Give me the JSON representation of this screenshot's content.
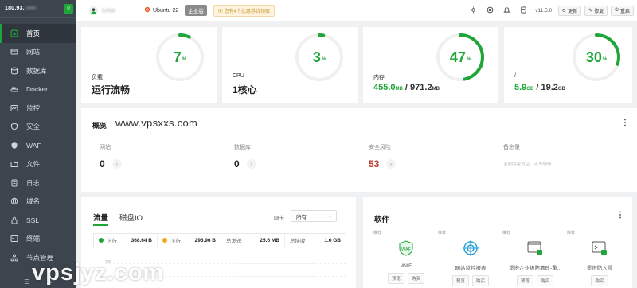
{
  "sidebar": {
    "ip": "180.93.",
    "ip_hidden": "▪▪▪▪▪",
    "count": "0",
    "items": [
      {
        "label": "首页",
        "icon": "home-icon"
      },
      {
        "label": "网站",
        "icon": "globe-icon"
      },
      {
        "label": "数据库",
        "icon": "database-icon"
      },
      {
        "label": "Docker",
        "icon": "docker-icon"
      },
      {
        "label": "监控",
        "icon": "monitor-icon"
      },
      {
        "label": "安全",
        "icon": "shield-icon"
      },
      {
        "label": "WAF",
        "icon": "waf-icon"
      },
      {
        "label": "文件",
        "icon": "folder-icon"
      },
      {
        "label": "日志",
        "icon": "log-icon"
      },
      {
        "label": "域名",
        "icon": "domain-icon"
      },
      {
        "label": "SSL",
        "icon": "ssl-icon"
      },
      {
        "label": "终端",
        "icon": "terminal-icon"
      },
      {
        "label": "节点管理",
        "icon": "node-icon"
      }
    ],
    "footer": [
      "☰",
      "✎"
    ]
  },
  "topbar": {
    "user": "Linux",
    "os": "Ubuntu 22",
    "edition": "企业版",
    "coupon": "您有4个优惠券待领取",
    "version": "v11.5.0",
    "btn_update": "更新",
    "btn_repair": "修复",
    "btn_restart": "重启"
  },
  "stats": [
    {
      "label": "负载",
      "value": "运行流畅",
      "percent": 7
    },
    {
      "label": "CPU",
      "value": "1核心",
      "percent": 3
    },
    {
      "label": "内存",
      "used": "455.0",
      "used_unit": "MB",
      "slash": " / ",
      "total": "971.2",
      "total_unit": "MB",
      "percent": 47
    },
    {
      "label": "/",
      "used": "5.9",
      "used_unit": "GB",
      "slash": " / ",
      "total": "19.2",
      "total_unit": "GB",
      "percent": 30
    }
  ],
  "percent_sign": "%",
  "overview": {
    "title": "概览",
    "site": "www.vpsxxs.com",
    "cols": [
      {
        "label": "网站",
        "value": "0"
      },
      {
        "label": "数据库",
        "value": "0"
      },
      {
        "label": "安全风险",
        "value": "53"
      },
      {
        "label": "备忘录",
        "note": "当前内容为空，点击编辑"
      }
    ]
  },
  "traffic": {
    "tab1": "流量",
    "tab2": "磁盘IO",
    "nic_label": "网卡",
    "nic_value": "所有",
    "up_label": "上行",
    "up_value": "368.64 B",
    "down_label": "下行",
    "down_value": "296.96 B",
    "sent_label": "总发送",
    "sent_value": "25.6 MB",
    "recv_label": "总接收",
    "recv_value": "1.0 GB",
    "axis_tick": "200",
    "colors": {
      "up": "#20a53a",
      "down": "#f5a623"
    }
  },
  "software": {
    "title": "软件",
    "items": [
      {
        "tag": "推荐",
        "name": "WAF",
        "btn1": "预览",
        "btn2": "购买"
      },
      {
        "tag": "推荐",
        "name": "网站监控报表",
        "btn1": "预览",
        "btn2": "购买"
      },
      {
        "tag": "推荐",
        "name": "堡塔企业级防篡改-重...",
        "btn1": "预览",
        "btn2": "购买"
      },
      {
        "tag": "推荐",
        "name": "堡塔防入侵",
        "btn2": "购买"
      }
    ]
  },
  "watermark": "vpsjyz.com",
  "colors": {
    "accent": "#20a53a",
    "sidebar": "#3c444d",
    "risk": "#c0392b"
  }
}
